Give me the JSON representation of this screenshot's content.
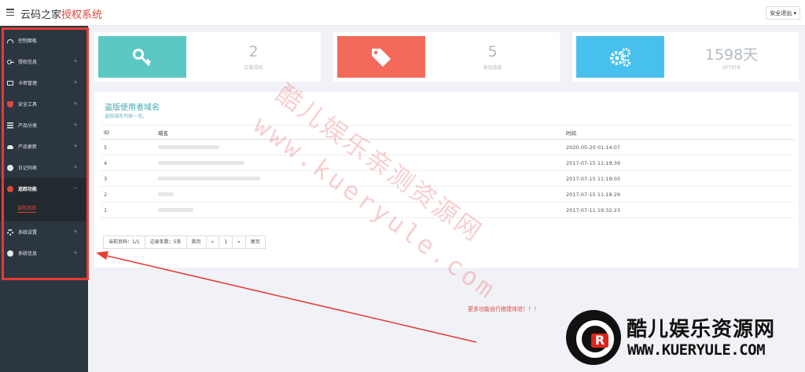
{
  "topbar": {
    "brand_prefix": "云码之家",
    "brand_accent": "授权系统",
    "logout_label": "安全退出"
  },
  "sidebar": {
    "items": [
      {
        "label": "控制面板",
        "icon": "dashboard-icon",
        "has_plus": false
      },
      {
        "label": "授权信息",
        "icon": "key-icon",
        "has_plus": true
      },
      {
        "label": "卡密管理",
        "icon": "card-icon",
        "has_plus": true
      },
      {
        "label": "安全工具",
        "icon": "shield-icon",
        "has_plus": true
      },
      {
        "label": "产品分类",
        "icon": "list-icon",
        "has_plus": true
      },
      {
        "label": "产品更新",
        "icon": "cloud-upload-icon",
        "has_plus": true
      },
      {
        "label": "日记列表",
        "icon": "info-icon",
        "has_plus": true
      },
      {
        "label": "追踪功能",
        "icon": "record-icon",
        "has_plus": false
      },
      {
        "label": "系统设置",
        "icon": "gears-icon",
        "has_plus": true
      },
      {
        "label": "系统信息",
        "icon": "help-icon",
        "has_plus": true
      }
    ],
    "sub_active": "盗版追踪",
    "plus": "+",
    "minus": "−"
  },
  "stats": [
    {
      "value": "2",
      "label": "正版授权",
      "color": "#5bc8c4",
      "icon": "key-icon"
    },
    {
      "value": "5",
      "label": "发现盗版",
      "color": "#f36a5a",
      "icon": "tag-icon"
    },
    {
      "value": "1598天",
      "label": "运行时长",
      "color": "#48c0ee",
      "icon": "gears-icon"
    }
  ],
  "panel": {
    "title": "盗版使用者域名",
    "description": "盗版域名列表一览。",
    "columns": [
      "ID",
      "域名",
      "时间"
    ],
    "rows": [
      {
        "id": "5",
        "time": "2020-05-20 01:14:07"
      },
      {
        "id": "4",
        "time": "2017-07-15 11:19:39"
      },
      {
        "id": "3",
        "time": "2017-07-15 11:19:03"
      },
      {
        "id": "2",
        "time": "2017-07-15 11:18:29"
      },
      {
        "id": "1",
        "time": "2017-07-11 19:32:23"
      }
    ],
    "pager": {
      "current": "当前页码：1/1",
      "total": "记录条数：5条",
      "first": "首页",
      "prev": "«",
      "page": "1",
      "next": "»",
      "last": "尾页"
    }
  },
  "watermark": {
    "line1": "酷儿娱乐亲测资源网",
    "line2": "www.kueryule.com"
  },
  "note": "更多功能自行搭建体验！！！",
  "logo": {
    "letter": "R",
    "name": "酷儿娱乐资源网",
    "url": "WWW.KUERYULE.COM"
  },
  "colors": {
    "accent": "#e0463c",
    "sidebar_bg": "#2b3640",
    "annotation": "#e73b33"
  }
}
